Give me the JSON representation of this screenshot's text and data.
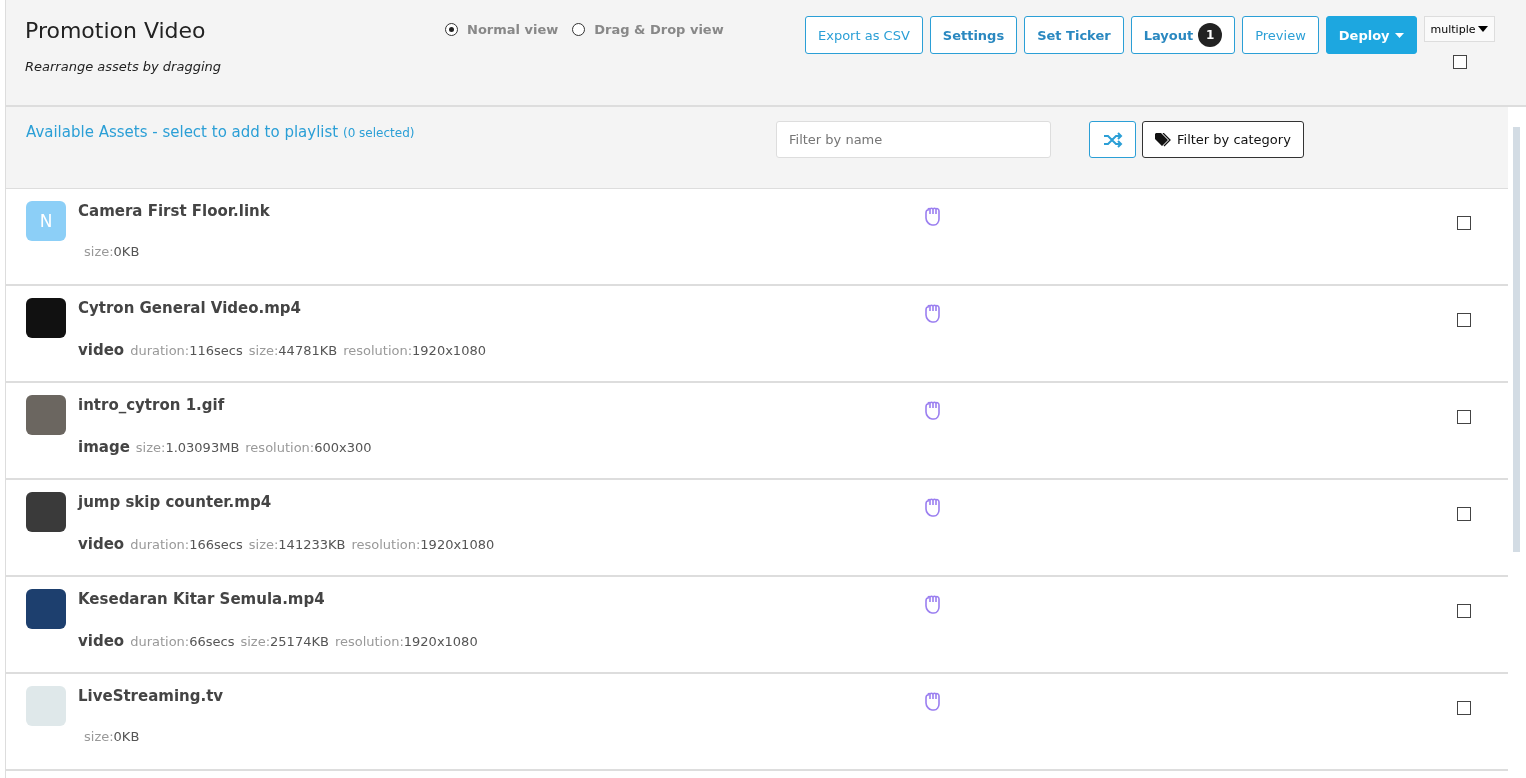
{
  "header": {
    "title": "Promotion Video",
    "subtitle": "Rearrange assets by dragging",
    "views": [
      {
        "label": "Normal view",
        "selected": true
      },
      {
        "label": "Drag & Drop view",
        "selected": false
      }
    ],
    "buttons": [
      {
        "label": "Export as CSV",
        "kind": "outline"
      },
      {
        "label": "Settings",
        "kind": "outline-bold"
      },
      {
        "label": "Set Ticker",
        "kind": "outline-bold"
      },
      {
        "label": "Layout",
        "kind": "outline-bold",
        "badge": "1"
      },
      {
        "label": "Preview",
        "kind": "outline"
      },
      {
        "label": "Deploy",
        "kind": "primary",
        "dropdown": true
      }
    ],
    "mode_select": "multiple",
    "select_all_checked": false
  },
  "assets": {
    "title": "Available Assets - select to add to playlist",
    "selected_count": "(0 selected)",
    "filter": {
      "placeholder": "Filter by name"
    },
    "category_button": "Filter by category",
    "rows": [
      {
        "name": "Camera First Floor.link",
        "thumb": {
          "kind": "letter",
          "text": "N"
        },
        "type": "",
        "meta": [
          {
            "label": "size:",
            "value": "0KB"
          }
        ],
        "checked": false
      },
      {
        "name": "Cytron General Video.mp4",
        "thumb": {
          "kind": "photo"
        },
        "type": "video",
        "meta": [
          {
            "label": "duration:",
            "value": "116secs"
          },
          {
            "label": "size:",
            "value": "44781KB"
          },
          {
            "label": "resolution:",
            "value": "1920x1080"
          }
        ],
        "checked": false
      },
      {
        "name": "intro_cytron 1.gif",
        "thumb": {
          "kind": "photo"
        },
        "type": "image",
        "meta": [
          {
            "label": "size:",
            "value": "1.03093MB"
          },
          {
            "label": "resolution:",
            "value": "600x300"
          }
        ],
        "checked": false
      },
      {
        "name": "jump skip counter.mp4",
        "thumb": {
          "kind": "photo"
        },
        "type": "video",
        "meta": [
          {
            "label": "duration:",
            "value": "166secs"
          },
          {
            "label": "size:",
            "value": "141233KB"
          },
          {
            "label": "resolution:",
            "value": "1920x1080"
          }
        ],
        "checked": false
      },
      {
        "name": "Kesedaran Kitar Semula.mp4",
        "thumb": {
          "kind": "photo"
        },
        "type": "video",
        "meta": [
          {
            "label": "duration:",
            "value": "66secs"
          },
          {
            "label": "size:",
            "value": "25174KB"
          },
          {
            "label": "resolution:",
            "value": "1920x1080"
          }
        ],
        "checked": false
      },
      {
        "name": "LiveStreaming.tv",
        "thumb": {
          "kind": "photo"
        },
        "type": "",
        "meta": [
          {
            "label": "size:",
            "value": "0KB"
          }
        ],
        "checked": false
      }
    ]
  }
}
